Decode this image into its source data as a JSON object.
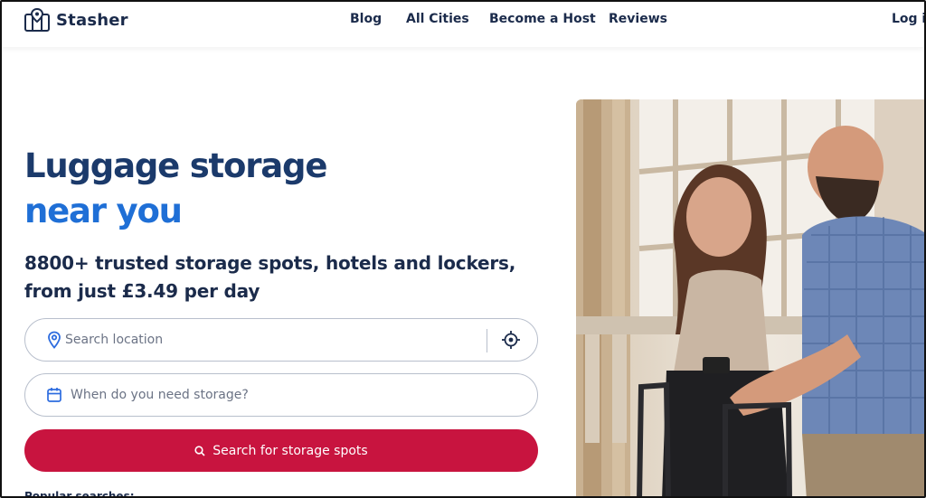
{
  "brand": {
    "name": "Stasher"
  },
  "nav": {
    "items": [
      {
        "label": "Blog"
      },
      {
        "label": "All Cities"
      },
      {
        "label": "Become a Host"
      },
      {
        "label": "Reviews"
      }
    ],
    "login": "Log in"
  },
  "hero": {
    "title_line1": "Luggage storage",
    "title_line2": "near you",
    "subtitle": "8800+ trusted storage spots, hotels and lockers, from just £3.49 per day"
  },
  "search": {
    "location_placeholder": "Search location",
    "date_placeholder": "When do you need storage?",
    "button_label": "Search for storage spots"
  },
  "popular": {
    "label": "Popular searches:"
  },
  "colors": {
    "title_dark": "#1b3a6b",
    "title_accent": "#1f6fd6",
    "button": "#c8143f",
    "icon_blue": "#2d6cdf"
  }
}
